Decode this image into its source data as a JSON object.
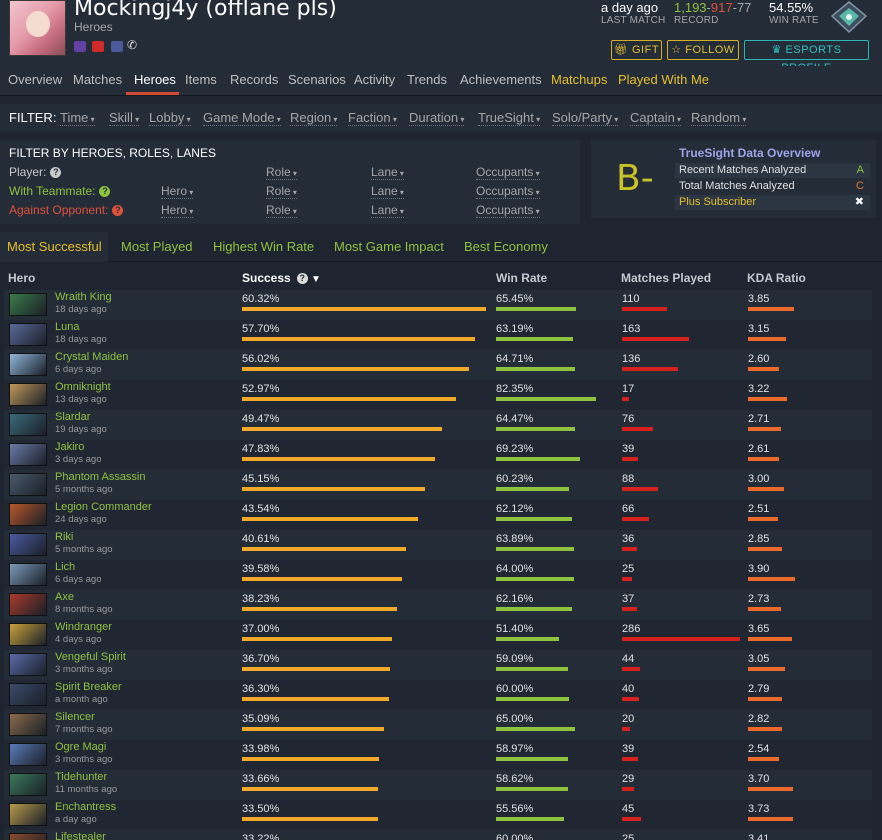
{
  "header": {
    "player_name": "Mockingj4y (offlane pls)",
    "subtitle": "Heroes",
    "last_match": {
      "value": "a day ago",
      "label": "LAST MATCH"
    },
    "record": {
      "wins": "1,193",
      "losses": "917",
      "abandons": "77",
      "sep": "-",
      "label": "RECORD"
    },
    "win_rate": {
      "value": "54.55%",
      "label": "WIN RATE"
    },
    "buttons": {
      "gift": "GIFT",
      "follow": "FOLLOW",
      "esports": "ESPORTS PROFILE"
    },
    "colors": {
      "wins": "#8fc23f",
      "losses": "#e0513a",
      "gold": "#e5c02c",
      "teal": "#2ec4c2"
    }
  },
  "nav": {
    "items": [
      {
        "label": "Overview"
      },
      {
        "label": "Matches"
      },
      {
        "label": "Heroes"
      },
      {
        "label": "Items"
      },
      {
        "label": "Records"
      },
      {
        "label": "Scenarios"
      },
      {
        "label": "Activity"
      },
      {
        "label": "Trends"
      },
      {
        "label": "Achievements"
      },
      {
        "label": "Matchups"
      },
      {
        "label": "Played With Me"
      }
    ],
    "active": "Heroes"
  },
  "filter": {
    "label": "FILTER:",
    "items": [
      "Time",
      "Skill",
      "Lobby",
      "Game Mode",
      "Region",
      "Faction",
      "Duration",
      "TrueSight",
      "Solo/Party",
      "Captain",
      "Random"
    ]
  },
  "filter_heroes": {
    "title": "FILTER BY HEROES, ROLES, LANES",
    "player_label": "Player:",
    "teammate_label": "With Teammate:",
    "opponent_label": "Against Opponent:",
    "hero": "Hero",
    "role": "Role",
    "lane": "Lane",
    "occupants": "Occupants"
  },
  "truesight": {
    "grade": "B-",
    "title": "TrueSight Data Overview",
    "recent_label": "Recent Matches Analyzed",
    "recent_grade": "A",
    "total_label": "Total Matches Analyzed",
    "total_grade": "C",
    "plus_label": "Plus Subscriber",
    "plus_mark": "✖"
  },
  "tabs": [
    "Most Successful",
    "Most Played",
    "Highest Win Rate",
    "Most Game Impact",
    "Best Economy"
  ],
  "table": {
    "headers": {
      "hero": "Hero",
      "success": "Success",
      "win_rate": "Win Rate",
      "matches": "Matches Played",
      "kda": "KDA Ratio"
    },
    "rows": [
      {
        "hero": "Wraith King",
        "time": "18 days ago",
        "success": "60.32%",
        "s": 60.32,
        "win_rate": "65.45%",
        "w": 65.45,
        "matches": "110",
        "m": 110,
        "kda": "3.85",
        "k": 3.85,
        "color": "#3c7a4a"
      },
      {
        "hero": "Luna",
        "time": "18 days ago",
        "success": "57.70%",
        "s": 57.7,
        "win_rate": "63.19%",
        "w": 63.19,
        "matches": "163",
        "m": 163,
        "kda": "3.15",
        "k": 3.15,
        "color": "#5a6a9a"
      },
      {
        "hero": "Crystal Maiden",
        "time": "6 days ago",
        "success": "56.02%",
        "s": 56.02,
        "win_rate": "64.71%",
        "w": 64.71,
        "matches": "136",
        "m": 136,
        "kda": "2.60",
        "k": 2.6,
        "color": "#8fb6d8"
      },
      {
        "hero": "Omniknight",
        "time": "13 days ago",
        "success": "52.97%",
        "s": 52.97,
        "win_rate": "82.35%",
        "w": 82.35,
        "matches": "17",
        "m": 17,
        "kda": "3.22",
        "k": 3.22,
        "color": "#c29a5a"
      },
      {
        "hero": "Slardar",
        "time": "19 days ago",
        "success": "49.47%",
        "s": 49.47,
        "win_rate": "64.47%",
        "w": 64.47,
        "matches": "76",
        "m": 76,
        "kda": "2.71",
        "k": 2.71,
        "color": "#3a6a7a"
      },
      {
        "hero": "Jakiro",
        "time": "3 days ago",
        "success": "47.83%",
        "s": 47.83,
        "win_rate": "69.23%",
        "w": 69.23,
        "matches": "39",
        "m": 39,
        "kda": "2.61",
        "k": 2.61,
        "color": "#6a7aa8"
      },
      {
        "hero": "Phantom Assassin",
        "time": "5 months ago",
        "success": "45.15%",
        "s": 45.15,
        "win_rate": "60.23%",
        "w": 60.23,
        "matches": "88",
        "m": 88,
        "kda": "3.00",
        "k": 3.0,
        "color": "#4a5a6a"
      },
      {
        "hero": "Legion Commander",
        "time": "24 days ago",
        "success": "43.54%",
        "s": 43.54,
        "win_rate": "62.12%",
        "w": 62.12,
        "matches": "66",
        "m": 66,
        "kda": "2.51",
        "k": 2.51,
        "color": "#b8582a"
      },
      {
        "hero": "Riki",
        "time": "5 months ago",
        "success": "40.61%",
        "s": 40.61,
        "win_rate": "63.89%",
        "w": 63.89,
        "matches": "36",
        "m": 36,
        "kda": "2.85",
        "k": 2.85,
        "color": "#4a5aa0"
      },
      {
        "hero": "Lich",
        "time": "6 days ago",
        "success": "39.58%",
        "s": 39.58,
        "win_rate": "64.00%",
        "w": 64.0,
        "matches": "25",
        "m": 25,
        "kda": "3.90",
        "k": 3.9,
        "color": "#7a9ab8"
      },
      {
        "hero": "Axe",
        "time": "8 months ago",
        "success": "38.23%",
        "s": 38.23,
        "win_rate": "62.16%",
        "w": 62.16,
        "matches": "37",
        "m": 37,
        "kda": "2.73",
        "k": 2.73,
        "color": "#a83a2a"
      },
      {
        "hero": "Windranger",
        "time": "4 days ago",
        "success": "37.00%",
        "s": 37.0,
        "win_rate": "51.40%",
        "w": 51.4,
        "matches": "286",
        "m": 286,
        "kda": "3.65",
        "k": 3.65,
        "color": "#c8a23a"
      },
      {
        "hero": "Vengeful Spirit",
        "time": "3 months ago",
        "success": "36.70%",
        "s": 36.7,
        "win_rate": "59.09%",
        "w": 59.09,
        "matches": "44",
        "m": 44,
        "kda": "3.05",
        "k": 3.05,
        "color": "#5a6aa8"
      },
      {
        "hero": "Spirit Breaker",
        "time": "a month ago",
        "success": "36.30%",
        "s": 36.3,
        "win_rate": "60.00%",
        "w": 60.0,
        "matches": "40",
        "m": 40,
        "kda": "2.79",
        "k": 2.79,
        "color": "#3a4a6a"
      },
      {
        "hero": "Silencer",
        "time": "7 months ago",
        "success": "35.09%",
        "s": 35.09,
        "win_rate": "65.00%",
        "w": 65.0,
        "matches": "20",
        "m": 20,
        "kda": "2.82",
        "k": 2.82,
        "color": "#8a6a4a"
      },
      {
        "hero": "Ogre Magi",
        "time": "3 months ago",
        "success": "33.98%",
        "s": 33.98,
        "win_rate": "58.97%",
        "w": 58.97,
        "matches": "39",
        "m": 39,
        "kda": "2.54",
        "k": 2.54,
        "color": "#5a7ab8"
      },
      {
        "hero": "Tidehunter",
        "time": "11 months ago",
        "success": "33.66%",
        "s": 33.66,
        "win_rate": "58.62%",
        "w": 58.62,
        "matches": "29",
        "m": 29,
        "kda": "3.70",
        "k": 3.7,
        "color": "#3a7a5a"
      },
      {
        "hero": "Enchantress",
        "time": "a day ago",
        "success": "33.50%",
        "s": 33.5,
        "win_rate": "55.56%",
        "w": 55.56,
        "matches": "45",
        "m": 45,
        "kda": "3.73",
        "k": 3.73,
        "color": "#b89a4a"
      },
      {
        "hero": "Lifestealer",
        "time": "",
        "success": "33.22%",
        "s": 33.22,
        "win_rate": "60.00%",
        "w": 60.0,
        "matches": "25",
        "m": 25,
        "kda": "3.41",
        "k": 3.41,
        "color": "#8a4a2a"
      }
    ]
  }
}
